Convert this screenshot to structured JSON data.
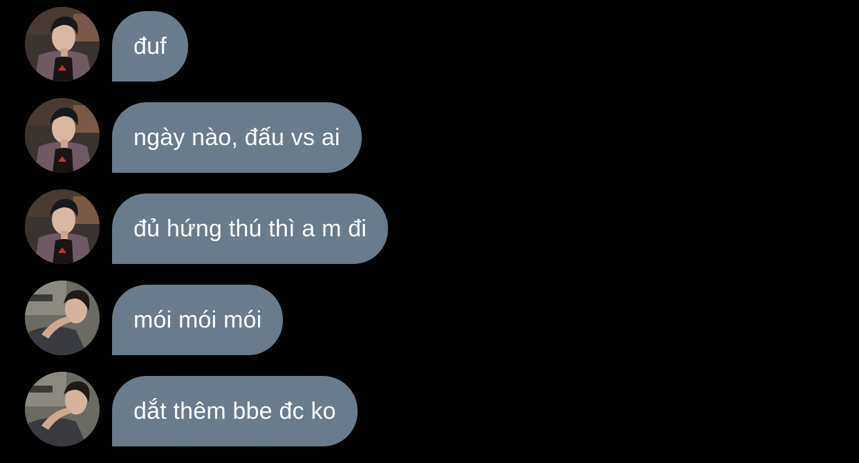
{
  "colors": {
    "background": "#000000",
    "bubble": "#6a7b8b",
    "text": "#ffffff"
  },
  "messages": [
    {
      "avatar": "profile-photo-person-a-icon",
      "text": "đuf"
    },
    {
      "avatar": "profile-photo-person-a-icon",
      "text": "ngày nào, đấu vs ai"
    },
    {
      "avatar": "profile-photo-person-a-icon",
      "text": "đủ hứng thú thì a m đi"
    },
    {
      "avatar": "profile-photo-person-b-icon",
      "text": "mói mói mói"
    },
    {
      "avatar": "profile-photo-person-b-icon",
      "text": "dắt thêm bbe đc ko"
    }
  ]
}
